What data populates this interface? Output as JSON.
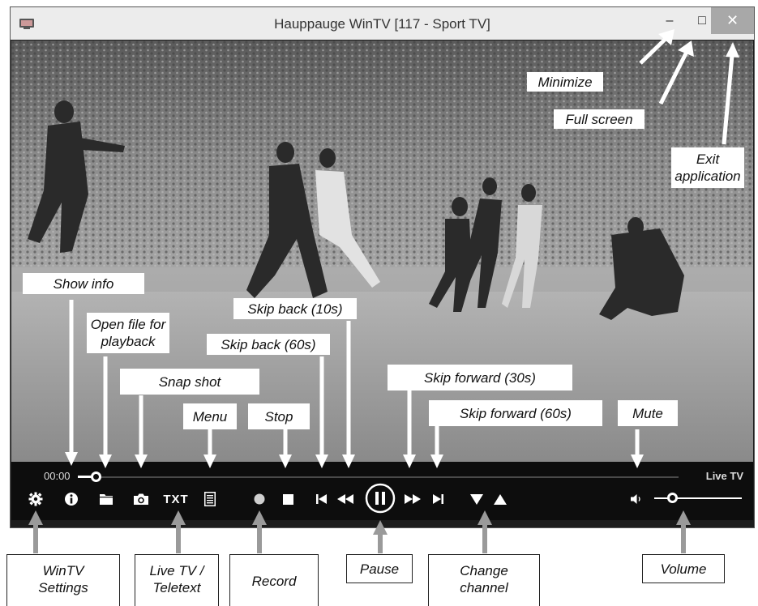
{
  "window": {
    "title": "Hauppauge WinTV [117 - Sport TV]",
    "minimize_symbol": "–",
    "maximize_symbol": "□",
    "close_symbol": "✕"
  },
  "player": {
    "time": "00:00",
    "live_label": "Live TV",
    "txt_label": "TXT",
    "seek_position": 0.0,
    "volume_level": 0.2
  },
  "callouts": {
    "minimize": "Minimize",
    "full_screen": "Full screen",
    "exit_application": "Exit application",
    "show_info": "Show info",
    "open_file": "Open file for playback",
    "skip_back_10": "Skip back (10s)",
    "skip_back_60": "Skip back (60s)",
    "snap_shot": "Snap shot",
    "menu": "Menu",
    "stop": "Stop",
    "skip_forward_30": "Skip forward (30s)",
    "skip_forward_60": "Skip forward (60s)",
    "mute": "Mute",
    "wintv_settings": "WinTV Settings",
    "live_tv_teletext": "Live TV / Teletext",
    "record": "Record",
    "pause": "Pause",
    "change_channel": "Change channel",
    "volume": "Volume"
  },
  "icons": [
    "app-icon",
    "minimize-icon",
    "maximize-icon",
    "close-icon",
    "gear-icon",
    "info-icon",
    "folder-icon",
    "camera-icon",
    "menu-list-icon",
    "record-icon",
    "stop-icon",
    "skip-back-60-icon",
    "skip-back-10-icon",
    "pause-icon",
    "skip-forward-30-icon",
    "skip-forward-60-icon",
    "channel-down-icon",
    "channel-up-icon",
    "speaker-icon"
  ]
}
